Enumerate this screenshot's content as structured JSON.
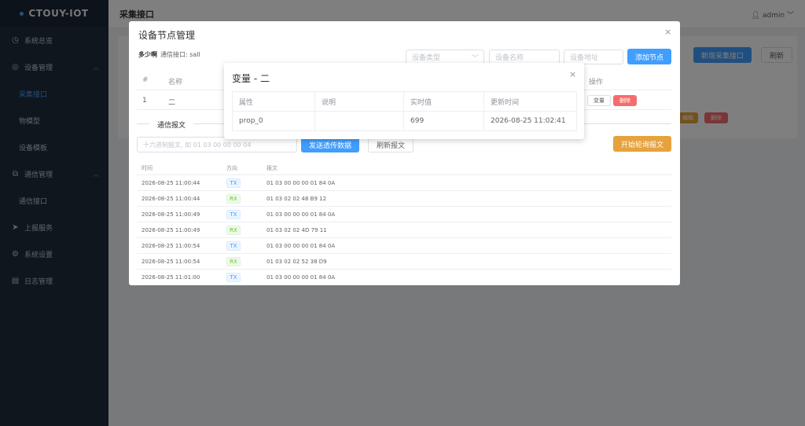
{
  "app": {
    "logo": "CTOUY-IOT"
  },
  "sidebar": {
    "items": [
      {
        "label": "系统总览",
        "icon": "dashboard-icon"
      },
      {
        "label": "设备管理",
        "icon": "device-icon"
      },
      {
        "label": "采集接口"
      },
      {
        "label": "物模型"
      },
      {
        "label": "设备模板"
      },
      {
        "label": "通信管理",
        "icon": "communication-icon"
      },
      {
        "label": "通信接口"
      },
      {
        "label": "上报服务",
        "icon": "send-icon"
      },
      {
        "label": "系统设置",
        "icon": "settings-icon"
      },
      {
        "label": "日志管理",
        "icon": "log-icon"
      }
    ]
  },
  "header": {
    "title": "采集接口",
    "user": "admin"
  },
  "background": {
    "add_interface": "新增采集接口",
    "refresh": "刷新",
    "edit": "编辑",
    "delete": "删除"
  },
  "device_dialog": {
    "title": "设备节点管理",
    "name": "多少啊",
    "interface": "通信接口: sall",
    "type_placeholder": "设备类型",
    "name_placeholder": "设备名称",
    "addr_placeholder": "设备地址",
    "add_node": "添加节点",
    "columns": {
      "index": "#",
      "name": "名称",
      "ops": "操作"
    },
    "row": {
      "index": "1",
      "name": "二",
      "var_btn": "变量",
      "del_btn": "删除"
    },
    "comm_section": "通信报文",
    "hex_placeholder": "十六进制报文, 如 01 03 00 00 00 04",
    "send": "发送透传数据",
    "refresh_msg": "刷新报文",
    "start_poll": "开始轮询报文",
    "log_columns": {
      "time": "时间",
      "dir": "方向",
      "msg": "报文"
    },
    "log": [
      {
        "time": "2026-08-25 11:00:44",
        "dir": "TX",
        "msg": "01 03 00 00 00 01 84 0A"
      },
      {
        "time": "2026-08-25 11:00:44",
        "dir": "RX",
        "msg": "01 03 02 02 48 B9 12"
      },
      {
        "time": "2026-08-25 11:00:49",
        "dir": "TX",
        "msg": "01 03 00 00 00 01 84 0A"
      },
      {
        "time": "2026-08-25 11:00:49",
        "dir": "RX",
        "msg": "01 03 02 02 4D 79 11"
      },
      {
        "time": "2026-08-25 11:00:54",
        "dir": "TX",
        "msg": "01 03 00 00 00 01 84 0A"
      },
      {
        "time": "2026-08-25 11:00:54",
        "dir": "RX",
        "msg": "01 03 02 02 52 38 D9"
      },
      {
        "time": "2026-08-25 11:01:00",
        "dir": "TX",
        "msg": "01 03 00 00 00 01 84 0A"
      }
    ]
  },
  "var_dialog": {
    "title": "变量 - 二",
    "columns": {
      "prop": "属性",
      "desc": "说明",
      "value": "实时值",
      "updated": "更新时间"
    },
    "rows": [
      {
        "prop": "prop_0",
        "desc": "",
        "value": "699",
        "updated": "2026-08-25 11:02:41"
      }
    ]
  }
}
